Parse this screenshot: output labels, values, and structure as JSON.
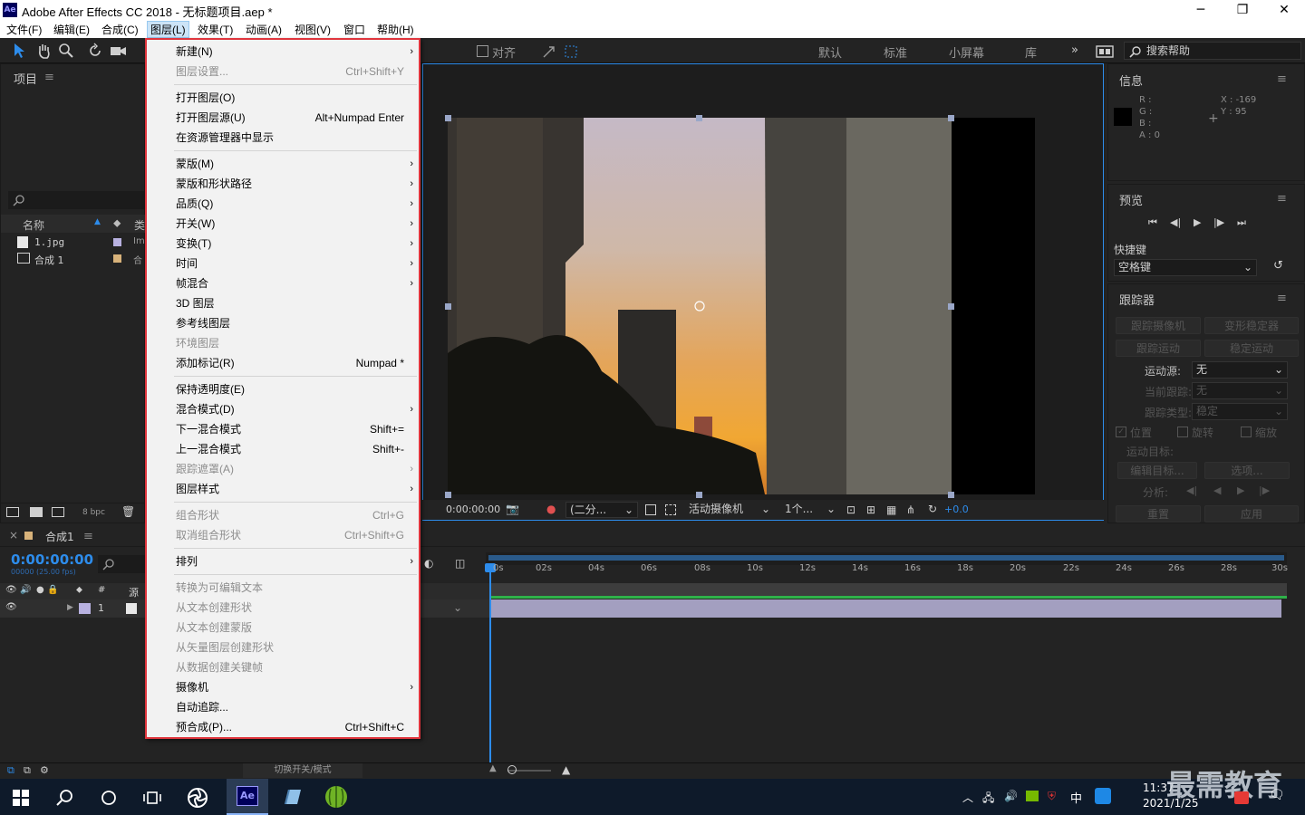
{
  "window": {
    "title": "Adobe After Effects CC 2018 - 无标题项目.aep *",
    "logo": "Ae",
    "minimize": "─",
    "restore": "❐",
    "close": "✕"
  },
  "menubar": [
    "文件(F)",
    "编辑(E)",
    "合成(C)",
    "图层(L)",
    "效果(T)",
    "动画(A)",
    "视图(V)",
    "窗口",
    "帮助(H)"
  ],
  "toolbar": {
    "align_label": "对齐",
    "workspaces": [
      "默认",
      "标准",
      "小屏幕",
      "库"
    ],
    "more": "»",
    "search_placeholder": "搜索帮助"
  },
  "project_panel": {
    "title": "项目",
    "columns": [
      "名称",
      "类"
    ],
    "items": [
      {
        "name": "1.jpg",
        "type": "Im",
        "color": "#b8b1e0"
      },
      {
        "name": "合成 1",
        "type": "合",
        "color": "#d8b27a"
      }
    ],
    "bpc": "8 bpc"
  },
  "layer_menu": [
    {
      "label": "新建(N)",
      "shortcut": "",
      "submenu": true,
      "disabled": false
    },
    {
      "label": "图层设置...",
      "shortcut": "Ctrl+Shift+Y",
      "submenu": false,
      "disabled": true
    },
    {
      "sep": true
    },
    {
      "label": "打开图层(O)",
      "shortcut": "",
      "submenu": false,
      "disabled": false
    },
    {
      "label": "打开图层源(U)",
      "shortcut": "Alt+Numpad Enter",
      "submenu": false,
      "disabled": false
    },
    {
      "label": "在资源管理器中显示",
      "shortcut": "",
      "submenu": false,
      "disabled": false
    },
    {
      "sep": true
    },
    {
      "label": "蒙版(M)",
      "shortcut": "",
      "submenu": true,
      "disabled": false
    },
    {
      "label": "蒙版和形状路径",
      "shortcut": "",
      "submenu": true,
      "disabled": false
    },
    {
      "label": "品质(Q)",
      "shortcut": "",
      "submenu": true,
      "disabled": false
    },
    {
      "label": "开关(W)",
      "shortcut": "",
      "submenu": true,
      "disabled": false
    },
    {
      "label": "变换(T)",
      "shortcut": "",
      "submenu": true,
      "disabled": false
    },
    {
      "label": "时间",
      "shortcut": "",
      "submenu": true,
      "disabled": false
    },
    {
      "label": "帧混合",
      "shortcut": "",
      "submenu": true,
      "disabled": false
    },
    {
      "label": "3D 图层",
      "shortcut": "",
      "submenu": false,
      "disabled": false
    },
    {
      "label": "参考线图层",
      "shortcut": "",
      "submenu": false,
      "disabled": false
    },
    {
      "label": "环境图层",
      "shortcut": "",
      "submenu": false,
      "disabled": true
    },
    {
      "label": "添加标记(R)",
      "shortcut": "Numpad *",
      "submenu": false,
      "disabled": false
    },
    {
      "sep": true
    },
    {
      "label": "保持透明度(E)",
      "shortcut": "",
      "submenu": false,
      "disabled": false
    },
    {
      "label": "混合模式(D)",
      "shortcut": "",
      "submenu": true,
      "disabled": false
    },
    {
      "label": "下一混合模式",
      "shortcut": "Shift+=",
      "submenu": false,
      "disabled": false
    },
    {
      "label": "上一混合模式",
      "shortcut": "Shift+-",
      "submenu": false,
      "disabled": false
    },
    {
      "label": "跟踪遮罩(A)",
      "shortcut": "",
      "submenu": true,
      "disabled": true
    },
    {
      "label": "图层样式",
      "shortcut": "",
      "submenu": true,
      "disabled": false
    },
    {
      "sep": true
    },
    {
      "label": "组合形状",
      "shortcut": "Ctrl+G",
      "submenu": false,
      "disabled": true
    },
    {
      "label": "取消组合形状",
      "shortcut": "Ctrl+Shift+G",
      "submenu": false,
      "disabled": true
    },
    {
      "sep": true
    },
    {
      "label": "排列",
      "shortcut": "",
      "submenu": true,
      "disabled": false
    },
    {
      "sep": true
    },
    {
      "label": "转换为可编辑文本",
      "shortcut": "",
      "submenu": false,
      "disabled": true
    },
    {
      "label": "从文本创建形状",
      "shortcut": "",
      "submenu": false,
      "disabled": true
    },
    {
      "label": "从文本创建蒙版",
      "shortcut": "",
      "submenu": false,
      "disabled": true
    },
    {
      "label": "从矢量图层创建形状",
      "shortcut": "",
      "submenu": false,
      "disabled": true
    },
    {
      "label": "从数据创建关键帧",
      "shortcut": "",
      "submenu": false,
      "disabled": true
    },
    {
      "label": "摄像机",
      "shortcut": "",
      "submenu": true,
      "disabled": false
    },
    {
      "label": "自动追踪...",
      "shortcut": "",
      "submenu": false,
      "disabled": false
    },
    {
      "label": "预合成(P)...",
      "shortcut": "Ctrl+Shift+C",
      "submenu": false,
      "disabled": false
    }
  ],
  "viewer_footer": {
    "timecode": "0:00:00:00",
    "resolution": "(二分...",
    "camera": "活动摄像机",
    "views": "1个...",
    "exposure": "+0.0"
  },
  "info_panel": {
    "title": "信息",
    "r": "R :",
    "g": "G :",
    "b": "B :",
    "a": "A : 0",
    "x": "X : -169",
    "y": "Y : 95"
  },
  "preview_panel": {
    "title": "预览",
    "shortcut_label": "快捷键",
    "shortcut_value": "空格键"
  },
  "tracker_panel": {
    "title": "跟踪器",
    "track_camera": "跟踪摄像机",
    "warp_stabilizer": "变形稳定器",
    "track_motion": "跟踪运动",
    "stabilize_motion": "稳定运动",
    "motion_source_label": "运动源:",
    "motion_source": "无",
    "current_track_label": "当前跟踪:",
    "current_track": "无",
    "track_type_label": "跟踪类型:",
    "track_type": "稳定",
    "position": "位置",
    "rotation": "旋转",
    "scale": "缩放",
    "motion_target": "运动目标:",
    "edit_target": "编辑目标...",
    "options": "选项...",
    "analyze": "分析:",
    "reset": "重置",
    "apply": "应用"
  },
  "timeline": {
    "comp_name": "合成1",
    "timecode": "0:00:00:00",
    "fps": "00000 (25.00 fps)",
    "ticks": [
      "0s",
      "02s",
      "04s",
      "06s",
      "08s",
      "10s",
      "12s",
      "14s",
      "16s",
      "18s",
      "20s",
      "22s",
      "24s",
      "26s",
      "28s",
      "30s"
    ],
    "layer_number": "1",
    "source_header": "源",
    "toggle_modes": "切换开关/模式"
  },
  "taskbar": {
    "time": "11:37",
    "date": "2021/1/25",
    "ime": "中",
    "watermark": "最需教育"
  }
}
